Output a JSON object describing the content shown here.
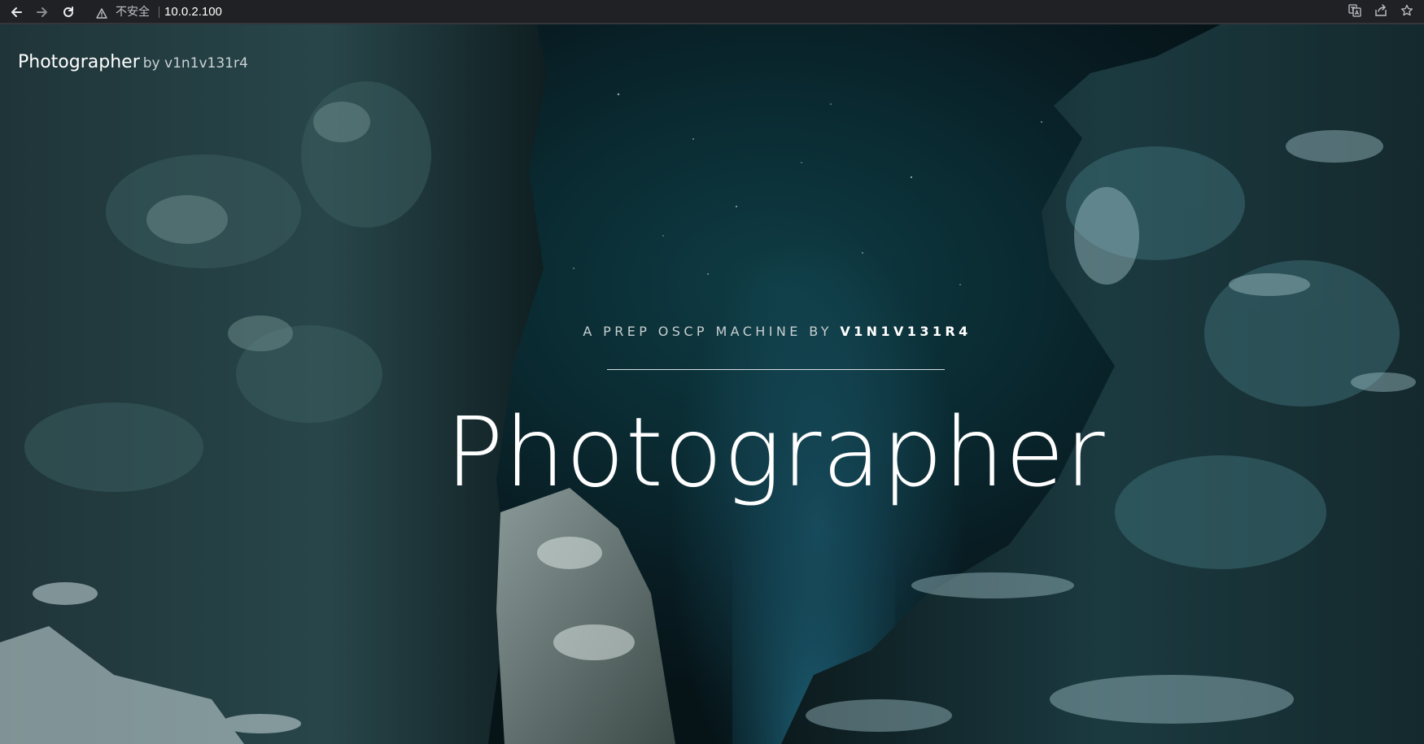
{
  "browser": {
    "security_label": "不安全",
    "url": "10.0.2.100",
    "icons": {
      "back": "arrow-left-icon",
      "forward": "arrow-right-icon",
      "reload": "reload-icon",
      "warning": "warning-triangle-icon",
      "translate": "translate-icon",
      "share": "share-icon",
      "bookmark": "star-icon"
    }
  },
  "header": {
    "brand_name": "Photographer",
    "brand_by": "by v1n1v131r4"
  },
  "hero": {
    "subtitle_prefix": "A PREP OSCP MACHINE BY ",
    "subtitle_author": "V1N1V131R4",
    "title": "Photographer"
  },
  "colors": {
    "chrome_bg": "#202124",
    "hero_text": "#ffffff",
    "sky": "#0f3c44"
  }
}
